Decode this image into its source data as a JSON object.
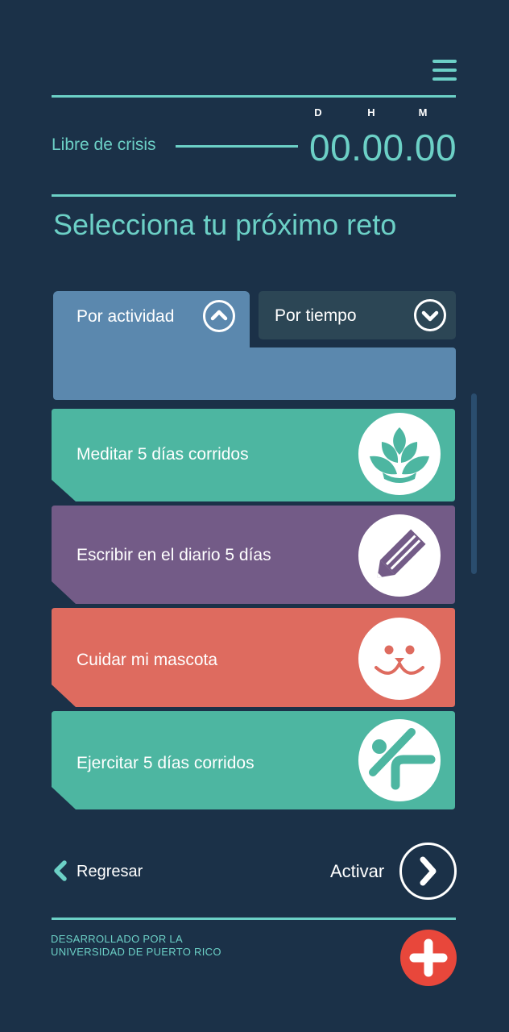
{
  "header": {
    "crisis_label": "Libre de crisis",
    "units": {
      "days": "D",
      "hours": "H",
      "minutes": "M"
    },
    "timer": "00.00.00"
  },
  "page_title": "Selecciona tu próximo reto",
  "tabs": [
    {
      "label": "Por actividad",
      "state": "expanded",
      "icon": "chevron-up-icon"
    },
    {
      "label": "Por tiempo",
      "state": "collapsed",
      "icon": "chevron-down-icon"
    }
  ],
  "challenges": [
    {
      "label": "Meditar 5 días corridos",
      "color": "#4db6a1",
      "icon": "lotus-icon"
    },
    {
      "label": "Escribir en el diario 5 días",
      "color": "#735b87",
      "icon": "pencil-icon"
    },
    {
      "label": "Cuidar mi mascota",
      "color": "#de6b5f",
      "icon": "pet-face-icon"
    },
    {
      "label": "Ejercitar 5 días corridos",
      "color": "#4db6a1",
      "icon": "exercise-person-icon"
    }
  ],
  "nav": {
    "back_label": "Regresar",
    "activate_label": "Activar"
  },
  "footer": {
    "line1": "DESARROLLADO POR LA",
    "line2": "UNIVERSIDAD DE PUERTO RICO"
  },
  "colors": {
    "background": "#1b3148",
    "accent": "#6cd0c6",
    "tab_active": "#5b88ae",
    "tab_inactive": "#2c4655",
    "emergency": "#e8473b"
  }
}
